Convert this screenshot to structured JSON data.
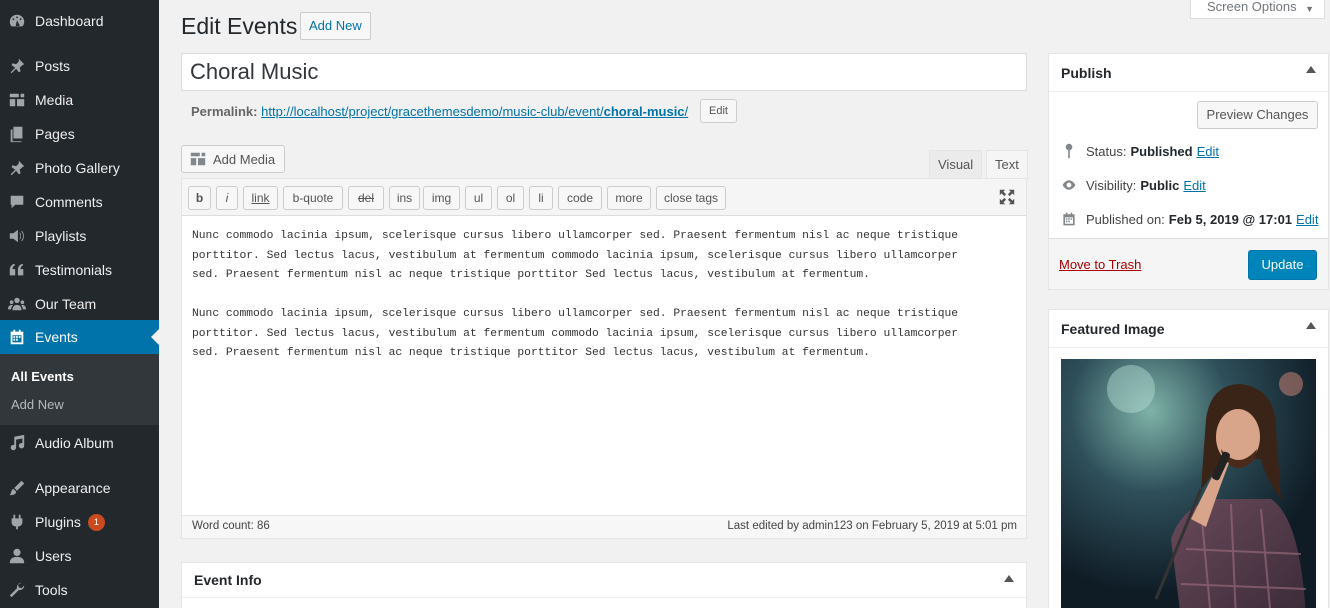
{
  "sidebar": {
    "items": [
      {
        "label": "Dashboard",
        "icon": "dashboard-icon"
      },
      {
        "label": "Posts",
        "icon": "pin-icon"
      },
      {
        "label": "Media",
        "icon": "media-icon"
      },
      {
        "label": "Pages",
        "icon": "pages-icon"
      },
      {
        "label": "Photo Gallery",
        "icon": "pin-icon"
      },
      {
        "label": "Comments",
        "icon": "comment-icon"
      },
      {
        "label": "Playlists",
        "icon": "speaker-icon"
      },
      {
        "label": "Testimonials",
        "icon": "quote-icon"
      },
      {
        "label": "Our Team",
        "icon": "groups-icon"
      },
      {
        "label": "Events",
        "icon": "calendar-icon"
      },
      {
        "label": "Audio Album",
        "icon": "music-icon"
      },
      {
        "label": "Appearance",
        "icon": "brush-icon"
      },
      {
        "label": "Plugins",
        "icon": "plugin-icon"
      },
      {
        "label": "Users",
        "icon": "user-icon"
      },
      {
        "label": "Tools",
        "icon": "wrench-icon"
      }
    ],
    "submenu": {
      "all_events": "All Events",
      "add_new": "Add New"
    },
    "plugins_badge": "1"
  },
  "header": {
    "title": "Edit Events",
    "add_new": "Add New",
    "screen_options": "Screen Options"
  },
  "post": {
    "title": "Choral Music",
    "permalink_label": "Permalink:",
    "permalink_base": "http://localhost/project/gracethemesdemo/music-club/event/",
    "permalink_slug": "choral-music",
    "permalink_trailing": "/",
    "permalink_edit": "Edit"
  },
  "editor": {
    "add_media": "Add Media",
    "tab_visual": "Visual",
    "tab_text": "Text",
    "quicktags": [
      "b",
      "i",
      "link",
      "b-quote",
      "del",
      "ins",
      "img",
      "ul",
      "ol",
      "li",
      "code",
      "more",
      "close tags"
    ],
    "content": "Nunc commodo lacinia ipsum, scelerisque cursus libero ullamcorper sed. Praesent fermentum nisl ac neque tristique\nporttitor. Sed lectus lacus, vestibulum at fermentum commodo lacinia ipsum, scelerisque cursus libero ullamcorper\nsed. Praesent fermentum nisl ac neque tristique porttitor Sed lectus lacus, vestibulum at fermentum.\n\nNunc commodo lacinia ipsum, scelerisque cursus libero ullamcorper sed. Praesent fermentum nisl ac neque tristique\nporttitor. Sed lectus lacus, vestibulum at fermentum commodo lacinia ipsum, scelerisque cursus libero ullamcorper\nsed. Praesent fermentum nisl ac neque tristique porttitor Sed lectus lacus, vestibulum at fermentum.",
    "word_count": "Word count: 86",
    "last_edited": "Last edited by admin123 on February 5, 2019 at 5:01 pm"
  },
  "event_info": {
    "title": "Event Info"
  },
  "publish": {
    "title": "Publish",
    "preview": "Preview Changes",
    "status_label": "Status:",
    "status_value": "Published",
    "visibility_label": "Visibility:",
    "visibility_value": "Public",
    "published_label": "Published on:",
    "published_value": "Feb 5, 2019 @ 17:01",
    "edit": "Edit",
    "trash": "Move to Trash",
    "update": "Update"
  },
  "featured": {
    "title": "Featured Image"
  },
  "colors": {
    "sidebar": "#23282d",
    "accent": "#0073aa",
    "button_primary": "#0085ba",
    "trash": "#a00"
  }
}
